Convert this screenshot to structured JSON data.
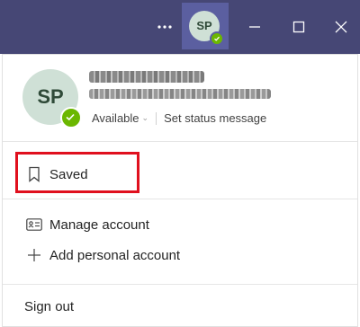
{
  "titlebar": {
    "more_icon": "ellipsis-icon",
    "avatar_initials": "SP",
    "minimize_icon": "minimize-icon",
    "maximize_icon": "maximize-icon",
    "close_icon": "close-icon",
    "bg_color": "#464775"
  },
  "profile": {
    "initials": "SP",
    "status": "Available",
    "status_color": "#6bb700",
    "set_status_label": "Set status message"
  },
  "menu": {
    "saved_label": "Saved",
    "manage_account_label": "Manage account",
    "add_personal_account_label": "Add personal account",
    "sign_out_label": "Sign out"
  },
  "annotation": {
    "highlight_color": "#e0101e"
  }
}
